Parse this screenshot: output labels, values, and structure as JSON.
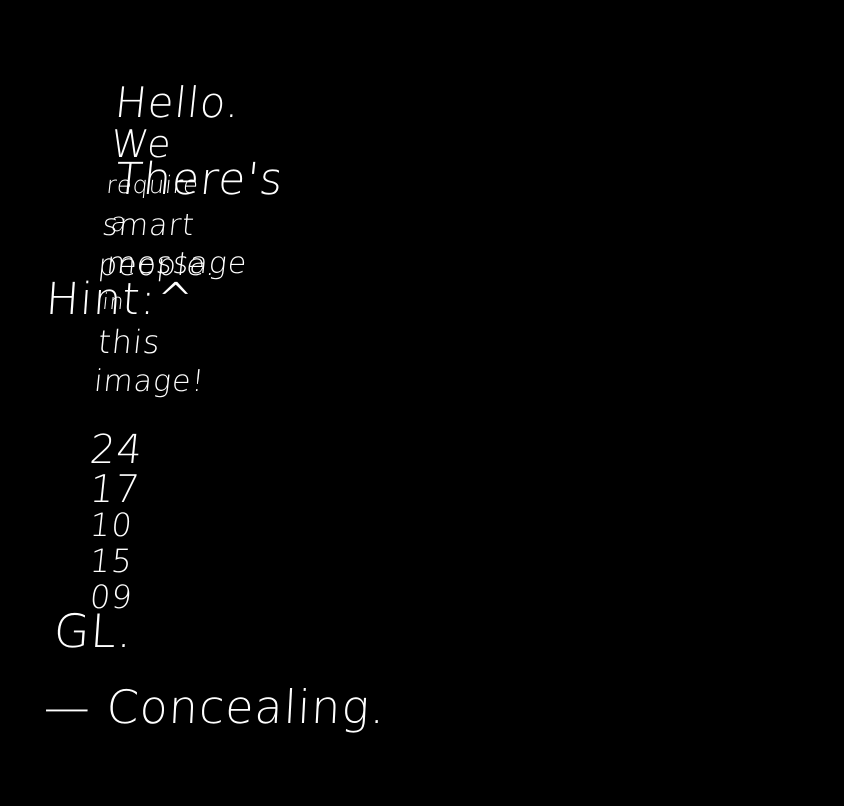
{
  "message": {
    "line1": [
      "Hello.",
      "We",
      "require",
      "smart",
      "people."
    ],
    "line2": [
      "There's",
      "a",
      "message",
      "in",
      "this",
      "image!"
    ],
    "hint": "Hint:^",
    "numbers": [
      "24",
      "17",
      "10",
      "15",
      "09"
    ],
    "gl": "GL.",
    "signature": "— Concealing."
  },
  "colors": {
    "background": "#000000",
    "text": "#ffffff"
  }
}
